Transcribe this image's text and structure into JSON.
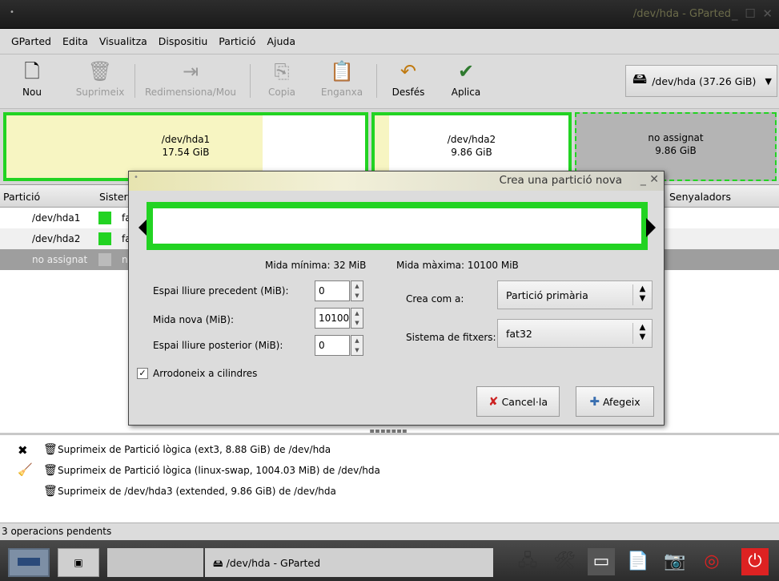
{
  "window": {
    "title": "/dev/hda - GParted",
    "buttons": "_ ☐ ✕"
  },
  "menu": [
    "GParted",
    "Edita",
    "Visualitza",
    "Dispositiu",
    "Partició",
    "Ajuda"
  ],
  "toolbar": {
    "nou": "Nou",
    "suprimeix": "Suprimeix",
    "redimensiona": "Redimensiona/Mou",
    "copia": "Copia",
    "enganxa": "Enganxa",
    "desfes": "Desfés",
    "aplica": "Aplica",
    "device": "/dev/hda  (37.26 GiB)"
  },
  "graph": {
    "p1_name": "/dev/hda1",
    "p1_size": "17.54 GiB",
    "p2_name": "/dev/hda2",
    "p2_size": "9.86 GiB",
    "p3_name": "no assignat",
    "p3_size": "9.86 GiB"
  },
  "list": {
    "headers": {
      "particio": "Partició",
      "sistema": "Sister",
      "senyaladors": "Senyaladors"
    },
    "rows": [
      {
        "name": "/dev/hda1",
        "fs": "fa"
      },
      {
        "name": "/dev/hda2",
        "fs": "fa"
      },
      {
        "name": "no assignat",
        "fs": "n"
      }
    ]
  },
  "dialog": {
    "title": "Crea una partició nova",
    "min": "Mida mínima: 32 MiB",
    "max": "Mida màxima: 10100 MiB",
    "espai_prev_label": "Espai lliure precedent (MiB):",
    "espai_prev_val": "0",
    "mida_label": "Mida nova (MiB):",
    "mida_val": "10100",
    "espai_post_label": "Espai lliure posterior (MiB):",
    "espai_post_val": "0",
    "crea_com_label": "Crea com a:",
    "crea_com_val": "Partició primària",
    "sistema_label": "Sistema de fitxers:",
    "sistema_val": "fat32",
    "round_label": "Arrodoneix a cilindres",
    "cancel": "Cancel·la",
    "add": "Afegeix"
  },
  "ops": [
    "Suprimeix de Partició lògica (ext3, 8.88 GiB) de /dev/hda",
    "Suprimeix de Partició lògica (linux-swap, 1004.03 MiB) de /dev/hda",
    "Suprimeix de /dev/hda3 (extended, 9.86 GiB) de /dev/hda"
  ],
  "status": "3 operacions pendents",
  "taskbar": {
    "window": "/dev/hda - GParted"
  },
  "colors": {
    "partition_border": "#22d322",
    "used_fill": "#f7f5c2",
    "selection": "#9e9e9e"
  }
}
